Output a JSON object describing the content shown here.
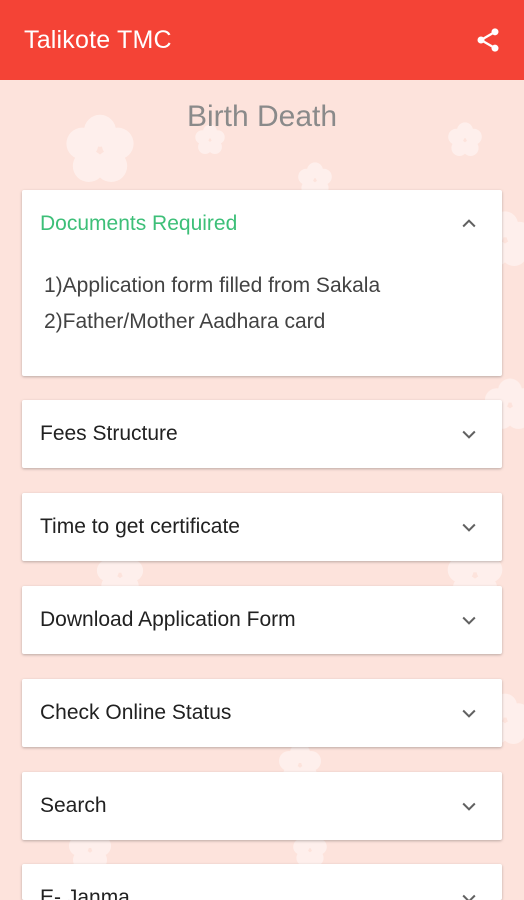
{
  "appbar": {
    "title": "Talikote TMC",
    "share_icon": "share-icon"
  },
  "page": {
    "title": "Birth Death"
  },
  "colors": {
    "appbar": "#f44336",
    "background": "#fde3dc",
    "accent_green": "#3dbf78"
  },
  "accordion": {
    "expanded": {
      "label": "Documents Required",
      "icon": "chevron-up-icon",
      "items": [
        "1)Application form filled from Sakala",
        "2)Father/Mother Aadhara card"
      ]
    },
    "collapsed": [
      {
        "label": "Fees Structure",
        "icon": "chevron-down-icon"
      },
      {
        "label": "Time to get certificate",
        "icon": "chevron-down-icon"
      },
      {
        "label": "Download Application Form",
        "icon": "chevron-down-icon"
      },
      {
        "label": "Check Online Status",
        "icon": "chevron-down-icon"
      },
      {
        "label": "Search",
        "icon": "chevron-down-icon"
      },
      {
        "label": "E- Janma",
        "icon": "chevron-down-icon"
      }
    ]
  }
}
